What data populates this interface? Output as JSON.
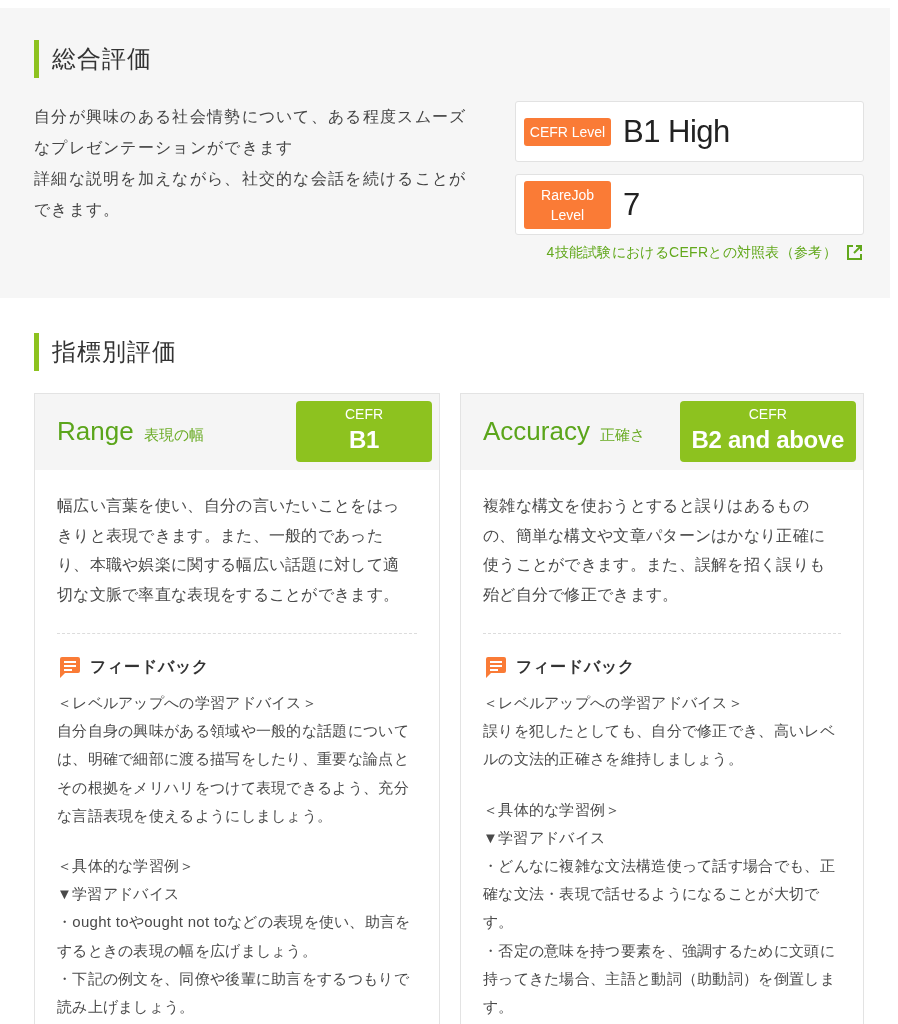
{
  "overall": {
    "title": "総合評価",
    "description": [
      "自分が興味のある社会情勢について、ある程度スムーズなプレゼンテーションができます",
      "詳細な説明を加えながら、社交的な会話を続けることができます。"
    ],
    "levels": [
      {
        "label": "CEFR Level",
        "value": "B1 High"
      },
      {
        "label": "RareJob Level",
        "value": "7"
      }
    ],
    "reference_link": "4技能試験におけるCEFRとの対照表（参考）"
  },
  "indicators": {
    "title": "指標別評価",
    "cards": [
      {
        "name": "Range",
        "subtitle": "表現の幅",
        "badge_label": "CEFR",
        "badge_value": "B1",
        "description": "幅広い言葉を使い、自分の言いたいことをはっきりと表現できます。また、一般的であったり、本職や娯楽に関する幅広い話題に対して適切な文脈で率直な表現をすることができます。",
        "feedback": {
          "title": "フィードバック",
          "blocks": [
            {
              "heading": "＜レベルアップへの学習アドバイス＞",
              "lines": [
                "自分自身の興味がある領域や一般的な話題については、明確で細部に渡る描写をしたり、重要な論点とその根拠をメリハリをつけて表現できるよう、充分な言語表現を使えるようにしましょう。"
              ]
            },
            {
              "heading": "＜具体的な学習例＞",
              "lines": [
                "▼学習アドバイス",
                "・ought toやought not toなどの表現を使い、助言をするときの表現の幅を広げましょう。",
                "・下記の例文を、同僚や後輩に助言をするつもりで読み上げましょう。"
              ]
            }
          ]
        }
      },
      {
        "name": "Accuracy",
        "subtitle": "正確さ",
        "badge_label": "CEFR",
        "badge_value": "B2 and above",
        "description": "複雑な構文を使おうとすると誤りはあるものの、簡単な構文や文章パターンはかなり正確に使うことができます。また、誤解を招く誤りも殆ど自分で修正できます。",
        "feedback": {
          "title": "フィードバック",
          "blocks": [
            {
              "heading": "＜レベルアップへの学習アドバイス＞",
              "lines": [
                "誤りを犯したとしても、自分で修正でき、高いレベルの文法的正確さを維持しましょう。"
              ]
            },
            {
              "heading": "＜具体的な学習例＞",
              "lines": [
                "▼学習アドバイス",
                "・どんなに複雑な文法構造使って話す場合でも、正確な文法・表現で話せるようになることが大切です。",
                "・否定の意味を持つ要素を、強調するために文頭に持ってきた場合、主語と動詞（助動詞）を倒置します。"
              ]
            }
          ]
        }
      }
    ]
  }
}
